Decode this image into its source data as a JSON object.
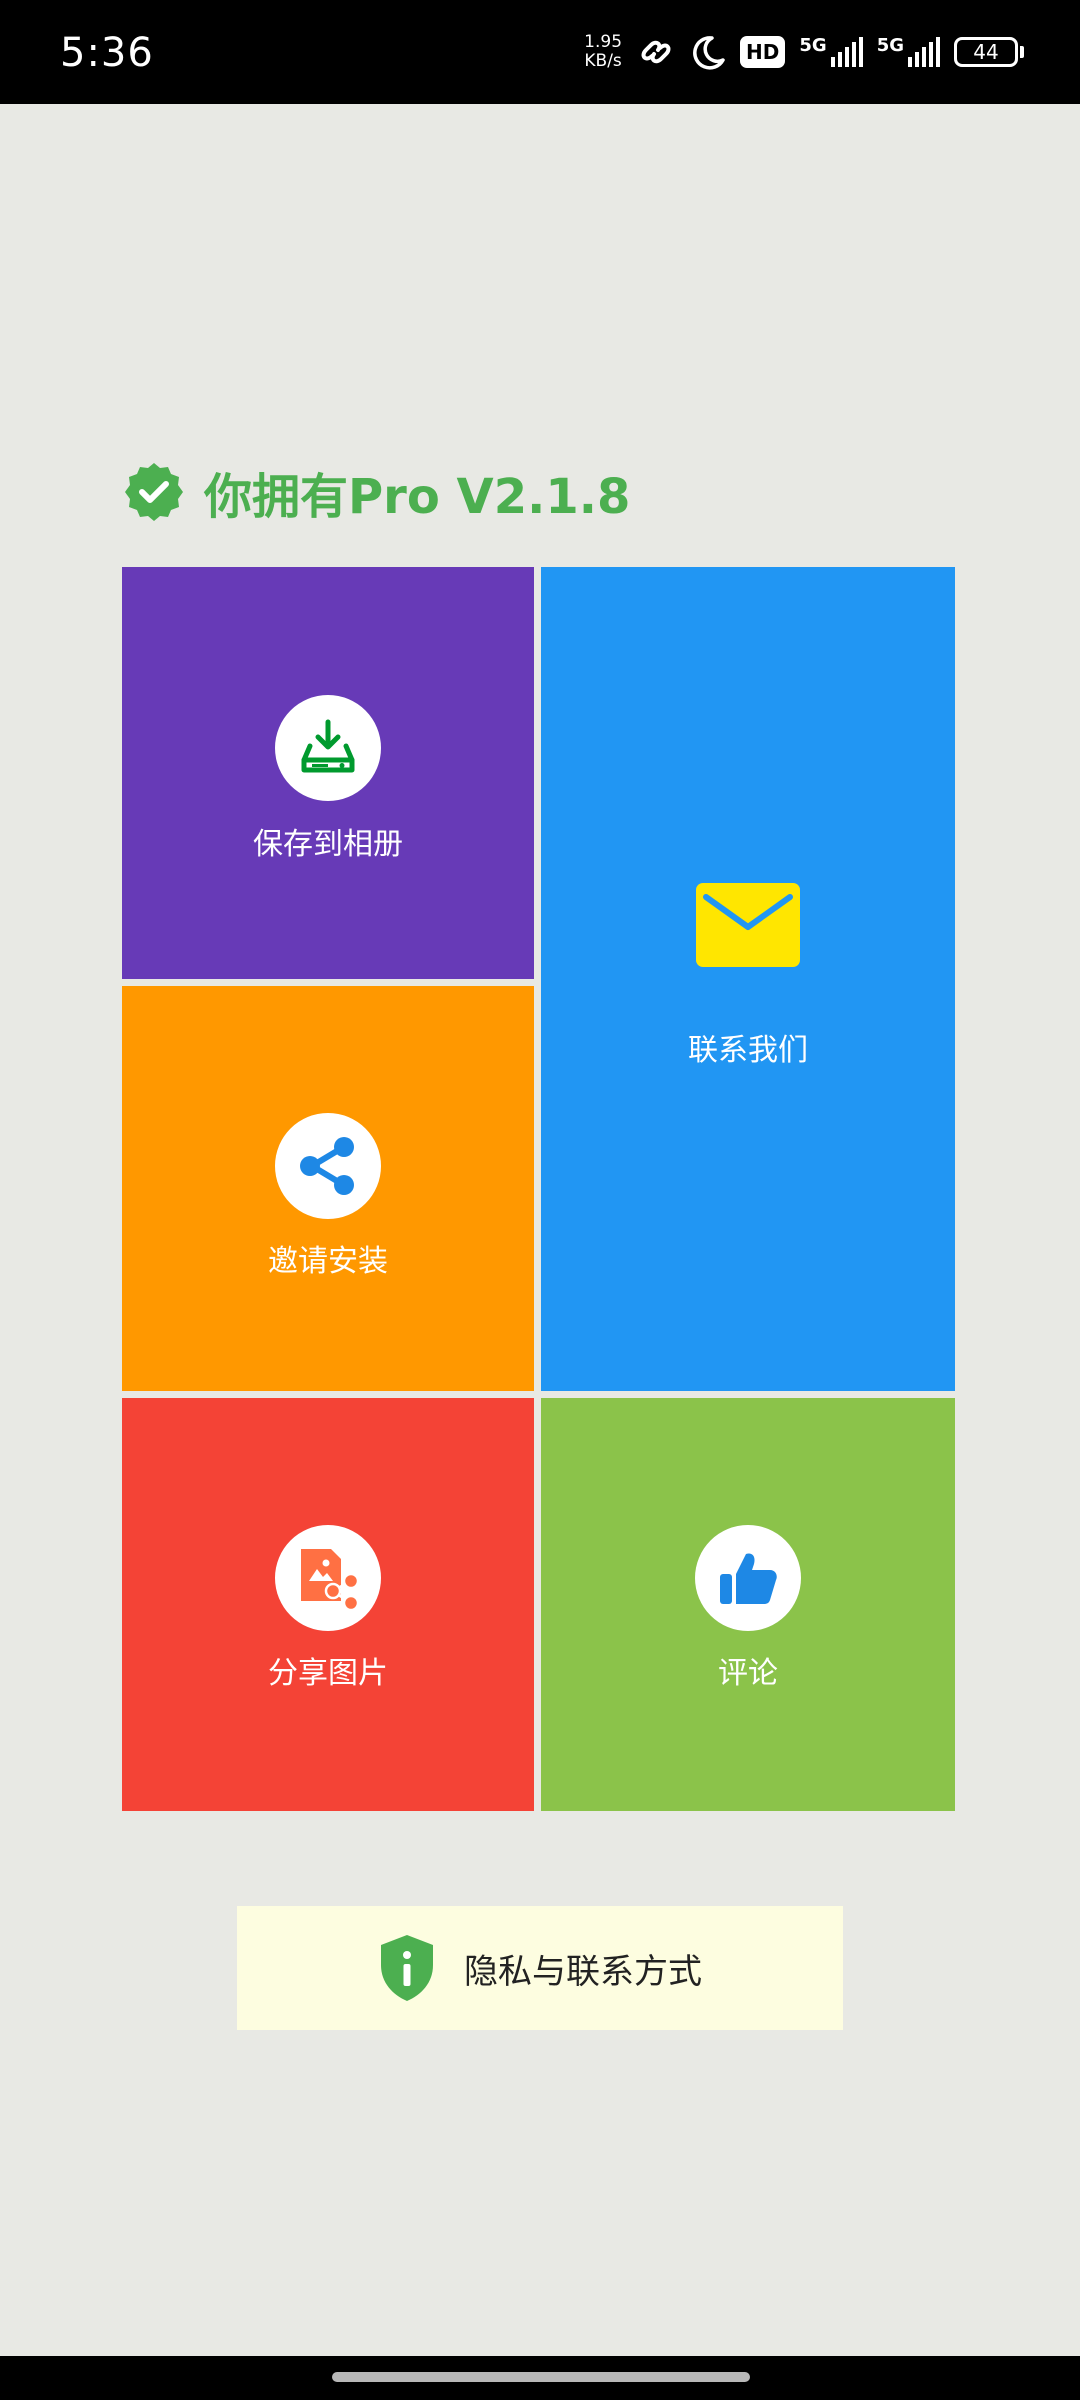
{
  "status_bar": {
    "time": "5:36",
    "net_speed_value": "1.95",
    "net_speed_unit": "KB/s",
    "hd_badge": "HD",
    "sim1_label": "5G",
    "sim2_label": "5G",
    "battery": "44",
    "icons": [
      "link-icon",
      "moon-icon",
      "hd-icon",
      "signal-icon",
      "signal-icon",
      "battery-icon"
    ]
  },
  "header": {
    "title": "你拥有Pro V2.1.8",
    "icon": "verified-badge-icon"
  },
  "tiles": {
    "save": {
      "label": "保存到相册",
      "color": "#673ab7",
      "icon": "download-tray-icon"
    },
    "contact": {
      "label": "联系我们",
      "color": "#2196f3",
      "icon": "mail-icon"
    },
    "invite": {
      "label": "邀请安装",
      "color": "#ff9800",
      "icon": "share-icon"
    },
    "share_picture": {
      "label": "分享图片",
      "color": "#f44336",
      "icon": "share-image-icon"
    },
    "review": {
      "label": "评论",
      "color": "#8bc34a",
      "icon": "thumbs-up-icon"
    }
  },
  "privacy": {
    "label": "隐私与联系方式",
    "icon": "shield-info-icon",
    "background": "#fdfde0"
  },
  "colors": {
    "page_background": "#e8e9e4",
    "accent_green": "#4caf50"
  }
}
